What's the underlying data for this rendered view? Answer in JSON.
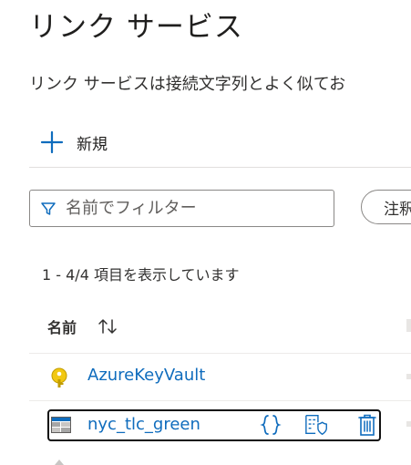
{
  "page": {
    "title": "リンク サービス",
    "description": "リンク サービスは接続文字列とよく似てお"
  },
  "toolbar": {
    "new_label": "新規"
  },
  "filter": {
    "placeholder": "名前でフィルター",
    "pill_label": "注釈"
  },
  "list": {
    "count_text": "1 - 4/4 項目を表示しています",
    "column_header": "名前",
    "rows": [
      {
        "name": "AzureKeyVault",
        "icon": "key-vault-icon",
        "selected": false
      },
      {
        "name": "nyc_tlc_green",
        "icon": "storage-table-icon",
        "selected": true,
        "actions": [
          "code-icon",
          "properties-shield-icon",
          "delete-icon"
        ]
      }
    ]
  },
  "colors": {
    "link": "#0f6cbd",
    "accent": "#0f6cbd",
    "key": "#f2c811",
    "border": "#8a8886",
    "divider": "#edebe9"
  }
}
